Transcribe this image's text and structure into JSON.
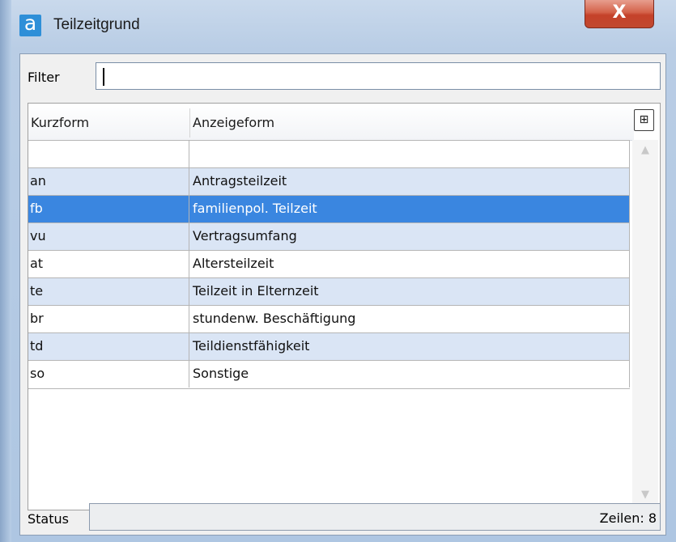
{
  "window": {
    "title": "Teilzeitgrund",
    "app_icon_glyph": "a",
    "close_glyph": "X",
    "accent_color": "#3a86e0"
  },
  "filter": {
    "label": "Filter",
    "value": ""
  },
  "grid": {
    "columns": [
      "Kurzform",
      "Anzeigeform"
    ],
    "column_chooser_icon": "column-chooser-icon",
    "rows": [
      {
        "kurzform": "",
        "anzeigeform": ""
      },
      {
        "kurzform": "an",
        "anzeigeform": "Antragsteilzeit"
      },
      {
        "kurzform": "fb",
        "anzeigeform": "familienpol. Teilzeit",
        "selected": true
      },
      {
        "kurzform": "vu",
        "anzeigeform": "Vertragsumfang"
      },
      {
        "kurzform": "at",
        "anzeigeform": "Altersteilzeit"
      },
      {
        "kurzform": "te",
        "anzeigeform": "Teilzeit in Elternzeit"
      },
      {
        "kurzform": "br",
        "anzeigeform": "stundenw. Beschäftigung"
      },
      {
        "kurzform": "td",
        "anzeigeform": "Teildienstfähigkeit"
      },
      {
        "kurzform": "so",
        "anzeigeform": "Sonstige"
      }
    ]
  },
  "status": {
    "label": "Status",
    "text": "Zeilen: 8"
  }
}
